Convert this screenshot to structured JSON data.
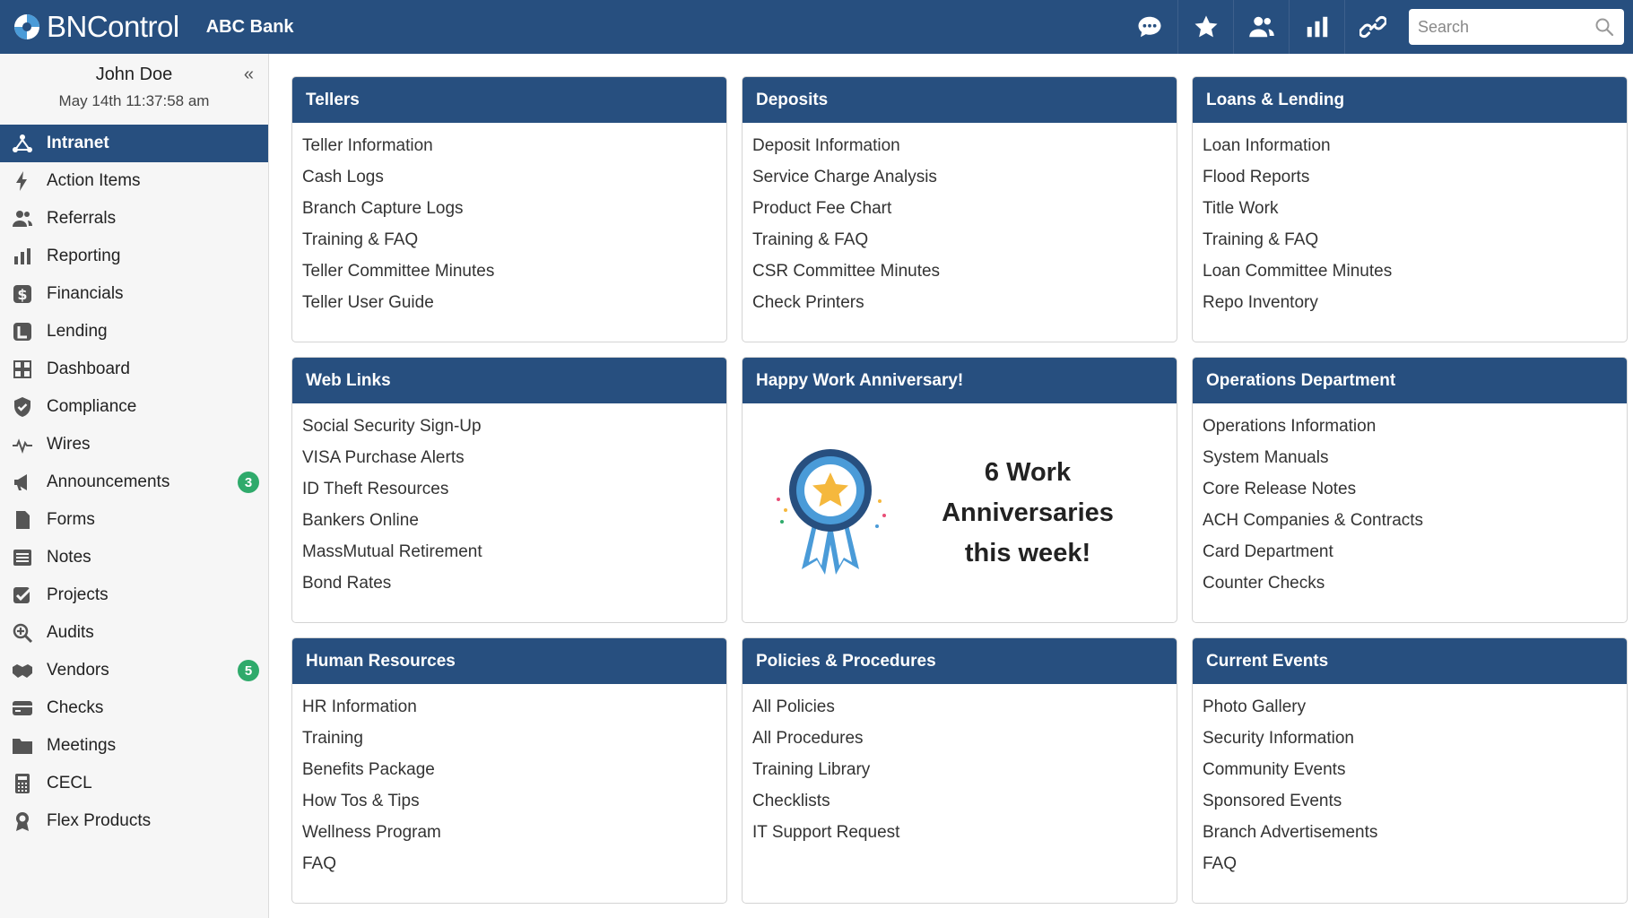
{
  "app": {
    "brand": "BNControl",
    "bank_name": "ABC Bank",
    "accent_color": "#274f7f",
    "badge_color": "#2faa6b"
  },
  "topbar": {
    "icons": [
      "chat-icon",
      "star-icon",
      "users-icon",
      "bar-chart-icon",
      "link-icon"
    ],
    "search": {
      "placeholder": "Search",
      "value": ""
    }
  },
  "user": {
    "name": "John Doe",
    "timestamp": "May 14th 11:37:58 am",
    "collapse_label": "«"
  },
  "sidebar": {
    "items": [
      {
        "label": "Intranet",
        "icon": "network-icon",
        "active": true
      },
      {
        "label": "Action Items",
        "icon": "bolt-icon"
      },
      {
        "label": "Referrals",
        "icon": "users-icon"
      },
      {
        "label": "Reporting",
        "icon": "bar-chart-icon"
      },
      {
        "label": "Financials",
        "icon": "dollar-icon"
      },
      {
        "label": "Lending",
        "icon": "lending-icon"
      },
      {
        "label": "Dashboard",
        "icon": "grid-icon"
      },
      {
        "label": "Compliance",
        "icon": "shield-icon"
      },
      {
        "label": "Wires",
        "icon": "pulse-icon"
      },
      {
        "label": "Announcements",
        "icon": "megaphone-icon",
        "badge": "3"
      },
      {
        "label": "Forms",
        "icon": "file-icon"
      },
      {
        "label": "Notes",
        "icon": "notes-icon"
      },
      {
        "label": "Projects",
        "icon": "check-square-icon"
      },
      {
        "label": "Audits",
        "icon": "search-plus-icon"
      },
      {
        "label": "Vendors",
        "icon": "handshake-icon",
        "badge": "5"
      },
      {
        "label": "Checks",
        "icon": "card-icon"
      },
      {
        "label": "Meetings",
        "icon": "folder-icon"
      },
      {
        "label": "CECL",
        "icon": "calculator-icon"
      },
      {
        "label": "Flex Products",
        "icon": "award-icon"
      }
    ]
  },
  "panels": {
    "tellers": {
      "title": "Tellers",
      "links": [
        "Teller Information",
        "Cash Logs",
        "Branch Capture Logs",
        "Training & FAQ",
        "Teller Committee Minutes",
        "Teller User Guide"
      ]
    },
    "deposits": {
      "title": "Deposits",
      "links": [
        "Deposit Information",
        "Service Charge Analysis",
        "Product Fee Chart",
        "Training & FAQ",
        "CSR Committee Minutes",
        "Check Printers"
      ]
    },
    "loans": {
      "title": "Loans & Lending",
      "links": [
        "Loan Information",
        "Flood Reports",
        "Title Work",
        "Training & FAQ",
        "Loan Committee Minutes",
        "Repo Inventory"
      ]
    },
    "weblinks": {
      "title": "Web Links",
      "links": [
        "Social Security Sign-Up",
        "VISA Purchase Alerts",
        "ID Theft Resources",
        "Bankers Online",
        "MassMutual Retirement",
        "Bond Rates"
      ]
    },
    "anniversary": {
      "title": "Happy Work Anniversary!",
      "line1": "6 Work",
      "line2": "Anniversaries",
      "line3": "this week!"
    },
    "operations": {
      "title": "Operations Department",
      "links": [
        "Operations Information",
        "System Manuals",
        "Core Release Notes",
        "ACH Companies & Contracts",
        "Card Department",
        "Counter Checks"
      ]
    },
    "hr": {
      "title": "Human Resources",
      "links": [
        "HR Information",
        "Training",
        "Benefits Package",
        "How Tos & Tips",
        "Wellness Program",
        "FAQ"
      ]
    },
    "policies": {
      "title": "Policies & Procedures",
      "links": [
        "All Policies",
        "All Procedures",
        "Training Library",
        "Checklists",
        "IT Support Request"
      ]
    },
    "events": {
      "title": "Current Events",
      "links": [
        "Photo Gallery",
        "Security Information",
        "Community Events",
        "Sponsored Events",
        "Branch Advertisements",
        "FAQ"
      ]
    }
  }
}
